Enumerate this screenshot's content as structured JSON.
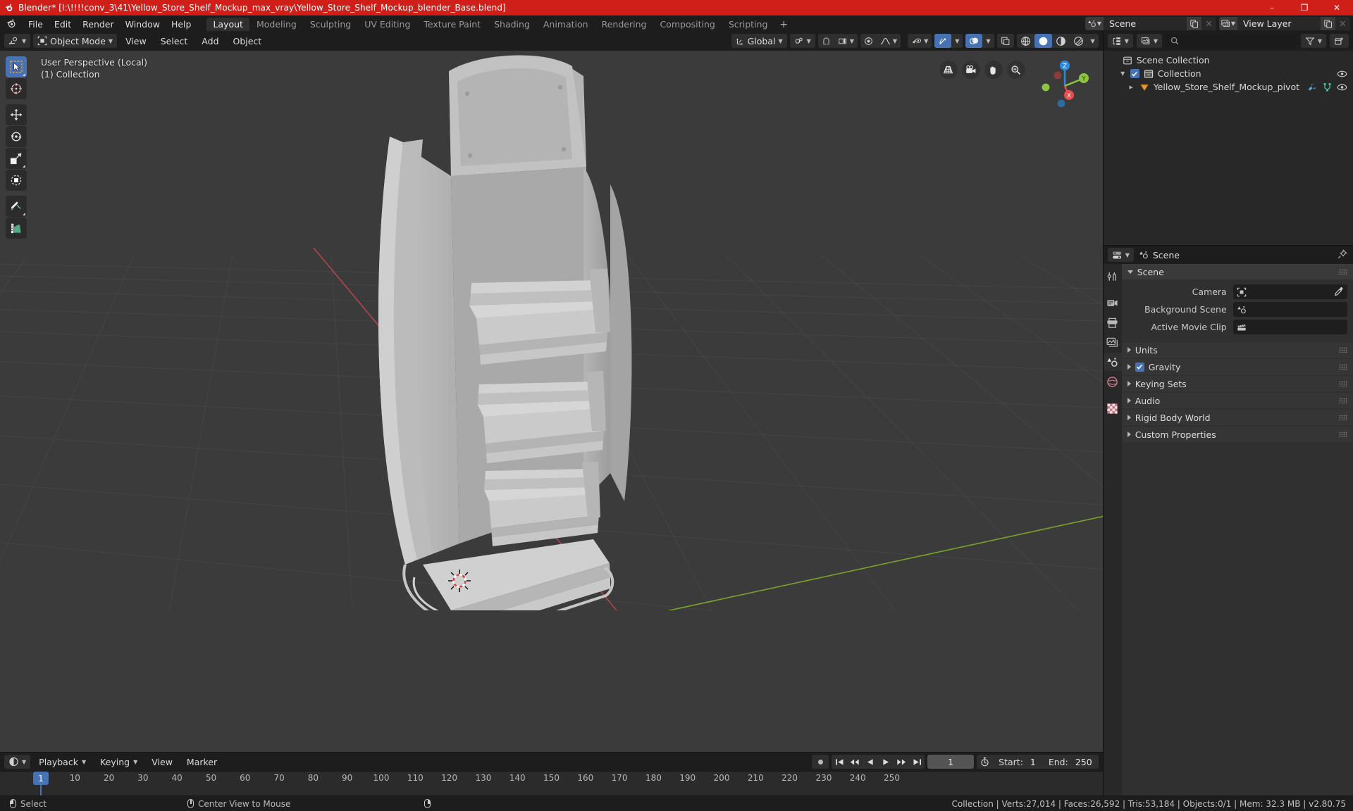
{
  "window": {
    "title": "Blender* [I:\\!!!!conv_3\\41\\Yellow_Store_Shelf_Mockup_max_vray\\Yellow_Store_Shelf_Mockup_blender_Base.blend]",
    "title_color": "#cf1f18",
    "minimize": "–",
    "maximize": "❐",
    "close": "✕"
  },
  "topbar": {
    "menus": [
      "File",
      "Edit",
      "Render",
      "Window",
      "Help"
    ],
    "workspace_tabs": [
      {
        "label": "Layout",
        "active": true
      },
      {
        "label": "Modeling",
        "active": false
      },
      {
        "label": "Sculpting",
        "active": false
      },
      {
        "label": "UV Editing",
        "active": false
      },
      {
        "label": "Texture Paint",
        "active": false
      },
      {
        "label": "Shading",
        "active": false
      },
      {
        "label": "Animation",
        "active": false
      },
      {
        "label": "Rendering",
        "active": false
      },
      {
        "label": "Compositing",
        "active": false
      },
      {
        "label": "Scripting",
        "active": false
      }
    ],
    "add_workspace": "+",
    "scene": {
      "icon": "scene-icon",
      "name": "Scene",
      "new_button": "new-scene-icon",
      "unlink_button": "✕"
    },
    "view_layer": {
      "icon": "view-layer-icon",
      "name": "View Layer",
      "new_button": "new-layer-icon",
      "unlink_button": "✕"
    }
  },
  "viewport": {
    "header": {
      "editor_type": "3d-viewport-icon",
      "mode": "Object Mode",
      "menus": [
        "View",
        "Select",
        "Add",
        "Object"
      ],
      "transform_orientation": "Global",
      "pivot_point": "pivot-icon",
      "snap_magnet": "magnet-icon",
      "snap_target": "snap-increment-icon",
      "proportional_edit": "proportional-edit-icon",
      "falloff": "smooth-falloff-icon",
      "visibility": "visibility-icon",
      "gizmo": "gizmo-icon",
      "overlays": "overlays-icon",
      "xray": "xray-icon",
      "shading_modes": [
        "wireframe",
        "solid",
        "material-preview",
        "rendered"
      ],
      "shading_active": "solid"
    },
    "overlay_text": {
      "perspective": "User Perspective (Local)",
      "collection": "(1) Collection"
    },
    "tools": [
      {
        "name": "tweak-select-box",
        "active": true
      },
      {
        "name": "cursor",
        "active": false
      },
      {
        "name": "move",
        "active": false
      },
      {
        "name": "rotate",
        "active": false
      },
      {
        "name": "scale",
        "active": false
      },
      {
        "name": "transform",
        "active": false
      },
      {
        "name": "annotate",
        "active": false
      },
      {
        "name": "measure",
        "active": false
      }
    ],
    "nav_buttons": [
      "grid-view-icon",
      "camera-view-icon",
      "hand-pan-icon",
      "zoom-icon"
    ],
    "gizmo_axes": [
      {
        "label": "Z",
        "color": "#2b8ce0"
      },
      {
        "label": "Y",
        "color": "#8cc63e"
      },
      {
        "label": "X",
        "color": "#e84c4c"
      }
    ],
    "background_color": "#3b3b3b",
    "grid_color": "#4b4b4b",
    "axis_x_color": "#c04a4a",
    "axis_y_color": "#7ba82c",
    "model_color": "#b9b9b9",
    "model_name": "yellow store shelf mockup"
  },
  "timeline": {
    "editor_type": "timeline-icon",
    "menus": [
      "Playback",
      "Keying",
      "View",
      "Marker"
    ],
    "record_button": "auto-keying-icon",
    "transport": [
      "jump-to-start",
      "jump-to-keyframe-prev",
      "play-reverse",
      "play",
      "jump-to-keyframe-next",
      "jump-to-end"
    ],
    "current_frame": "1",
    "use_preview_range_icon": "stopwatch-icon",
    "start_label": "Start:",
    "start_value": "1",
    "end_label": "End:",
    "end_value": "250",
    "ruler_ticks": [
      "10",
      "20",
      "30",
      "40",
      "50",
      "60",
      "70",
      "80",
      "90",
      "100",
      "110",
      "120",
      "130",
      "140",
      "150",
      "160",
      "170",
      "180",
      "190",
      "200",
      "210",
      "220",
      "230",
      "240",
      "250"
    ],
    "playhead_label": "1"
  },
  "outliner": {
    "display_mode_icon": "outliner-display-icon",
    "filter_id_icon": "view-layer-icon",
    "search_placeholder": "",
    "filter_icon": "filter-icon",
    "new_collection_icon": "new-collection-icon",
    "rows": [
      {
        "indent": 0,
        "disclosure": "",
        "checkbox": false,
        "icon": "scene-collection-icon",
        "label": "Scene Collection",
        "restrict": []
      },
      {
        "indent": 1,
        "disclosure": "▼",
        "checkbox": true,
        "icon": "collection-icon",
        "label": "Collection",
        "restrict": [
          "eye-icon"
        ]
      },
      {
        "indent": 2,
        "disclosure": "▶",
        "checkbox": false,
        "icon": "empty-plain-axes-icon",
        "label": "Yellow_Store_Shelf_Mockup_pivot",
        "restrict": [
          "modifier-icon",
          "object-data-icon",
          "eye-icon"
        ]
      }
    ]
  },
  "properties": {
    "editor_type_icon": "properties-icon",
    "breadcrumb_icon": "scene-props-icon",
    "breadcrumb": "Scene",
    "pin_icon": "pin-icon",
    "tabs": [
      {
        "name": "tool",
        "selected": false
      },
      {
        "name": "render",
        "selected": false
      },
      {
        "name": "output",
        "selected": false
      },
      {
        "name": "view-layer",
        "selected": false
      },
      {
        "name": "scene",
        "selected": true
      },
      {
        "name": "world",
        "selected": false
      },
      {
        "name": "texture",
        "selected": false
      }
    ],
    "panels": [
      {
        "title": "Scene",
        "open": true,
        "rows": [
          {
            "label": "Camera",
            "field_icon": "camera-data-icon",
            "value": "",
            "eyedropper": true
          },
          {
            "label": "Background Scene",
            "field_icon": "scene-data-icon",
            "value": "",
            "eyedropper": false
          },
          {
            "label": "Active Movie Clip",
            "field_icon": "movie-clip-icon",
            "value": "",
            "eyedropper": false
          }
        ]
      },
      {
        "title": "Units",
        "open": false,
        "checkbox": null
      },
      {
        "title": "Gravity",
        "open": false,
        "checkbox": true
      },
      {
        "title": "Keying Sets",
        "open": false,
        "checkbox": null
      },
      {
        "title": "Audio",
        "open": false,
        "checkbox": null
      },
      {
        "title": "Rigid Body World",
        "open": false,
        "checkbox": null
      },
      {
        "title": "Custom Properties",
        "open": false,
        "checkbox": null
      }
    ]
  },
  "statusbar": {
    "keymap": [
      {
        "mouse": "left",
        "label": "Select"
      },
      {
        "mouse": "middle",
        "label": "Center View to Mouse"
      },
      {
        "mouse": "right",
        "label": ""
      }
    ],
    "stats": "Collection | Verts:27,014 | Faces:26,592 | Tris:53,184 | Objects:0/1 | Mem: 32.3 MB | v2.80.75"
  }
}
